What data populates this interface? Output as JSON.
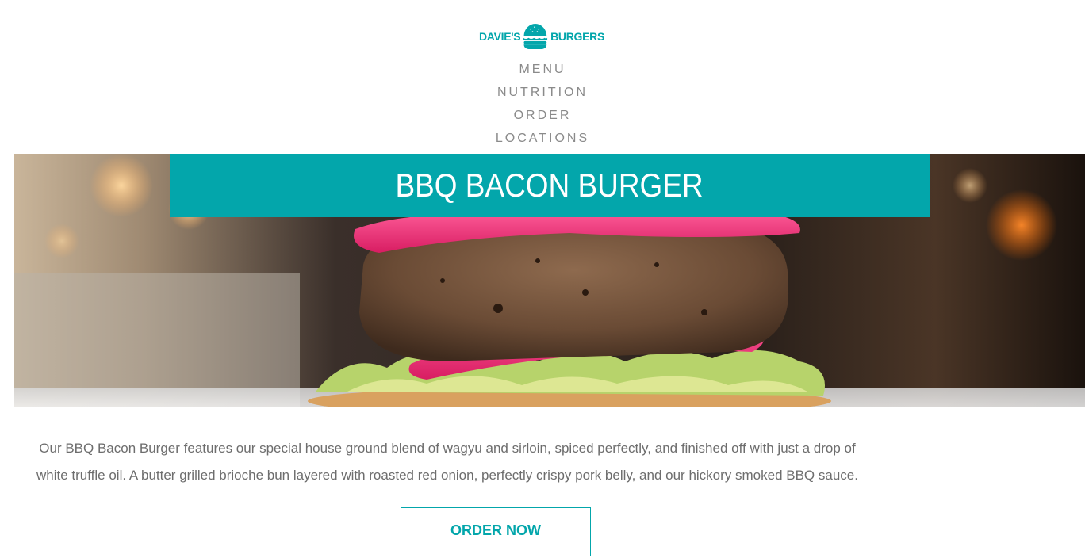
{
  "brand": {
    "left_word": "DAVIE'S",
    "right_word": "BURGERS",
    "accent_color": "#03a6ab"
  },
  "nav": {
    "items": [
      {
        "label": "MENU"
      },
      {
        "label": "NUTRITION"
      },
      {
        "label": "ORDER"
      },
      {
        "label": "LOCATIONS"
      }
    ]
  },
  "hero": {
    "title": "BBQ BACON BURGER",
    "image": "burger-photo"
  },
  "description": "Our BBQ Bacon Burger features our special house ground blend of wagyu and sirloin, spiced perfectly, and finished off with just a drop of white truffle oil. A butter grilled brioche bun layered with roasted red onion, perfectly crispy pork belly, and our hickory smoked BBQ sauce.",
  "cta": {
    "label": "ORDER NOW"
  }
}
